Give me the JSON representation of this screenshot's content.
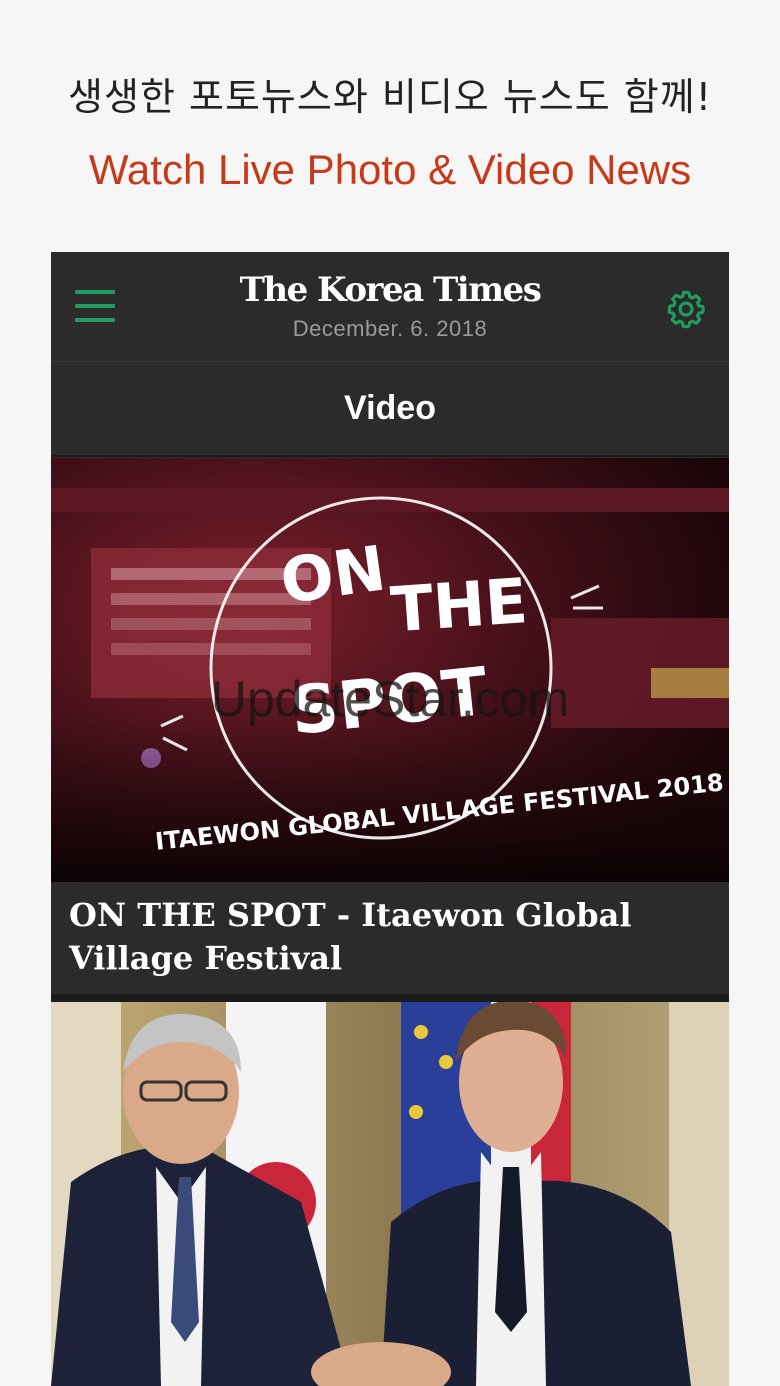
{
  "promo": {
    "headline_ko": "생생한 포토뉴스와 비디오 뉴스도 함께!",
    "headline_en": "Watch Live Photo & Video News"
  },
  "app": {
    "brand": "The Korea Times",
    "date": "December. 6. 2018",
    "section_title": "Video",
    "menu_icon": "hamburger-menu-icon",
    "settings_icon": "gear-icon",
    "accent_color": "#1f9c5e"
  },
  "articles": [
    {
      "title": "ON THE SPOT - Itaewon Global Village Festival",
      "thumbnail": {
        "line1": "ON",
        "line2": "THE",
        "line3": "SPOT",
        "subtitle": "ITAEWON GLOBAL VILLAGE FESTIVAL 2018"
      }
    },
    {
      "title": "",
      "thumbnail": {}
    }
  ],
  "watermark": "UpdateStar.com"
}
